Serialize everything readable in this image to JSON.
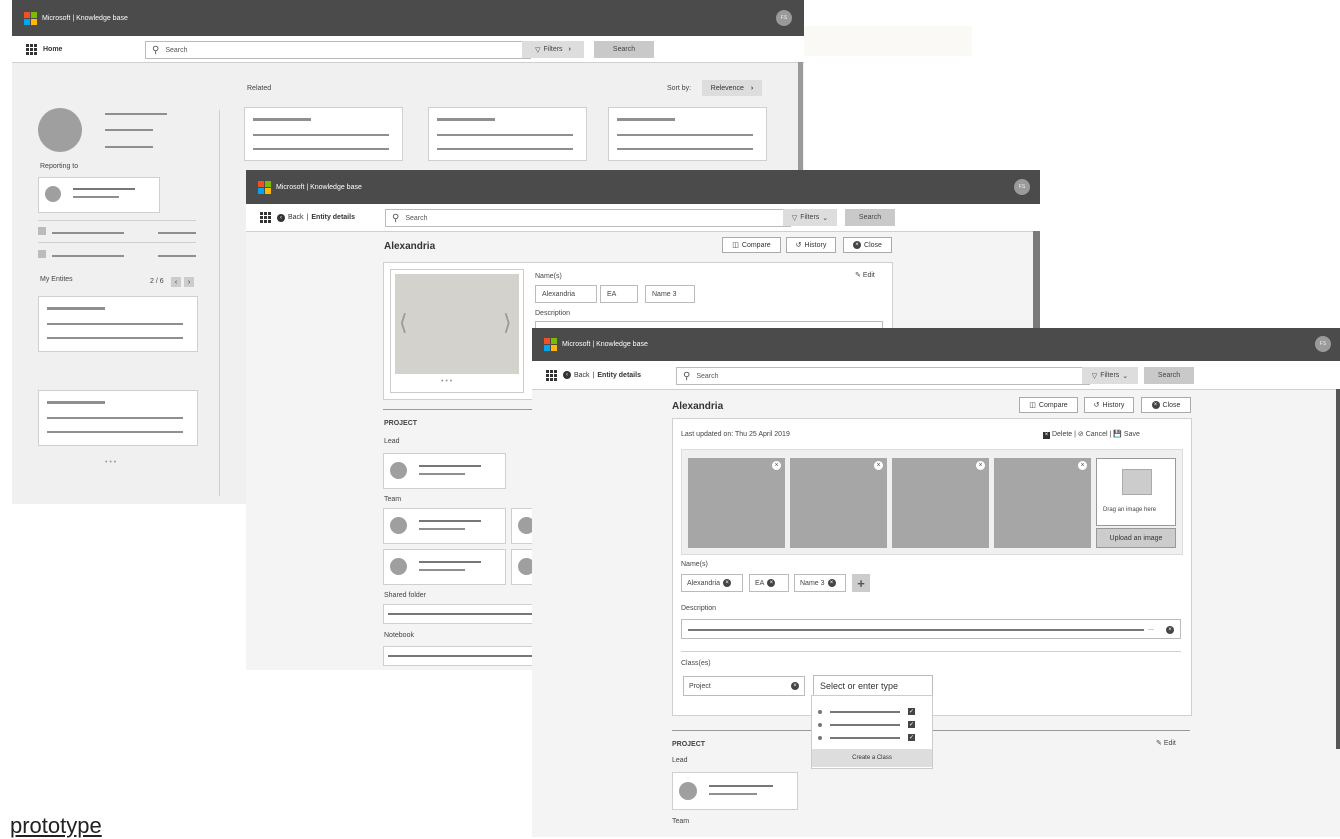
{
  "app_title": "Microsoft | Knowledge base",
  "avatar_initials": "FS",
  "search_placeholder": "Search",
  "search_button": "Search",
  "filters_label": "Filters",
  "footer_link": "prototype",
  "home_window": {
    "home_label": "Home",
    "related_label": "Related",
    "sort_by_label": "Sort by:",
    "sort_value": "Relevence",
    "reporting_to": "Reporting to",
    "my_entities": "My Entites",
    "pagination": "2 / 6",
    "dots": "• • •"
  },
  "detail_window": {
    "back_label": "Back",
    "breadcrumb": "Entity details",
    "entity_title": "Alexandria",
    "compare": "Compare",
    "history": "History",
    "close": "Close",
    "edit": "Edit",
    "names_label": "Name(s)",
    "names": [
      "Alexandria",
      "EA",
      "Name 3"
    ],
    "description_label": "Description",
    "project_label": "PROJECT",
    "lead_label": "Lead",
    "team_label": "Team",
    "shared_folder_label": "Shared folder",
    "notebook_label": "Notebook",
    "dots": "• • •"
  },
  "edit_window": {
    "back_label": "Back",
    "breadcrumb": "Entity details",
    "entity_title": "Alexandria",
    "compare": "Compare",
    "history": "History",
    "close": "Close",
    "last_updated": "Last updated on: Thu 25 April 2019",
    "delete": "Delete",
    "cancel": "Cancel",
    "save": "Save",
    "drag_image": "Drag an image here",
    "upload_image": "Upload an image",
    "names_label": "Name(s)",
    "names": [
      "Alexandria",
      "EA",
      "Name 3"
    ],
    "description_label": "Description",
    "ellipsis": "...",
    "classes_label": "Class(es)",
    "class_value": "Project",
    "class_placeholder": "Select or enter type",
    "create_class": "Create a Class",
    "project_label": "PROJECT",
    "edit": "Edit",
    "lead_label": "Lead",
    "team_label": "Team"
  }
}
